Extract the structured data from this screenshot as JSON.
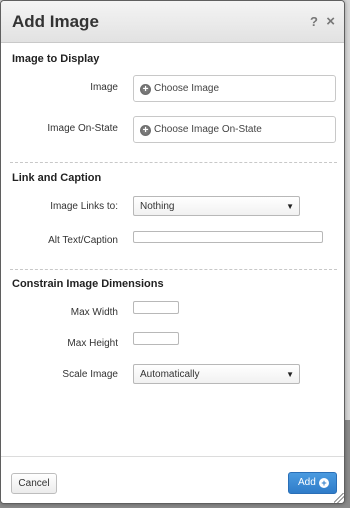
{
  "dialog": {
    "title": "Add Image",
    "help_icon": "?",
    "close_icon": "×"
  },
  "sections": {
    "display": {
      "title": "Image to Display",
      "image_label": "Image",
      "image_button": "Choose Image",
      "onstate_label": "Image On-State",
      "onstate_button": "Choose Image On-State"
    },
    "link": {
      "title": "Link and Caption",
      "links_label": "Image Links to:",
      "links_value": "Nothing",
      "alt_label": "Alt Text/Caption",
      "alt_value": ""
    },
    "constrain": {
      "title": "Constrain Image Dimensions",
      "max_width_label": "Max Width",
      "max_width_value": "",
      "max_height_label": "Max Height",
      "max_height_value": "",
      "scale_label": "Scale Image",
      "scale_value": "Automatically"
    }
  },
  "footer": {
    "cancel_label": "Cancel",
    "add_label": "Add"
  },
  "icons": {
    "plus": "plus-circle-icon",
    "add": "add-circle-icon",
    "caret": "caret-down-icon",
    "resize": "resize-grip-icon"
  },
  "colors": {
    "primary_button": "#2f7cc9",
    "titlebar": "#e9e9e9"
  }
}
